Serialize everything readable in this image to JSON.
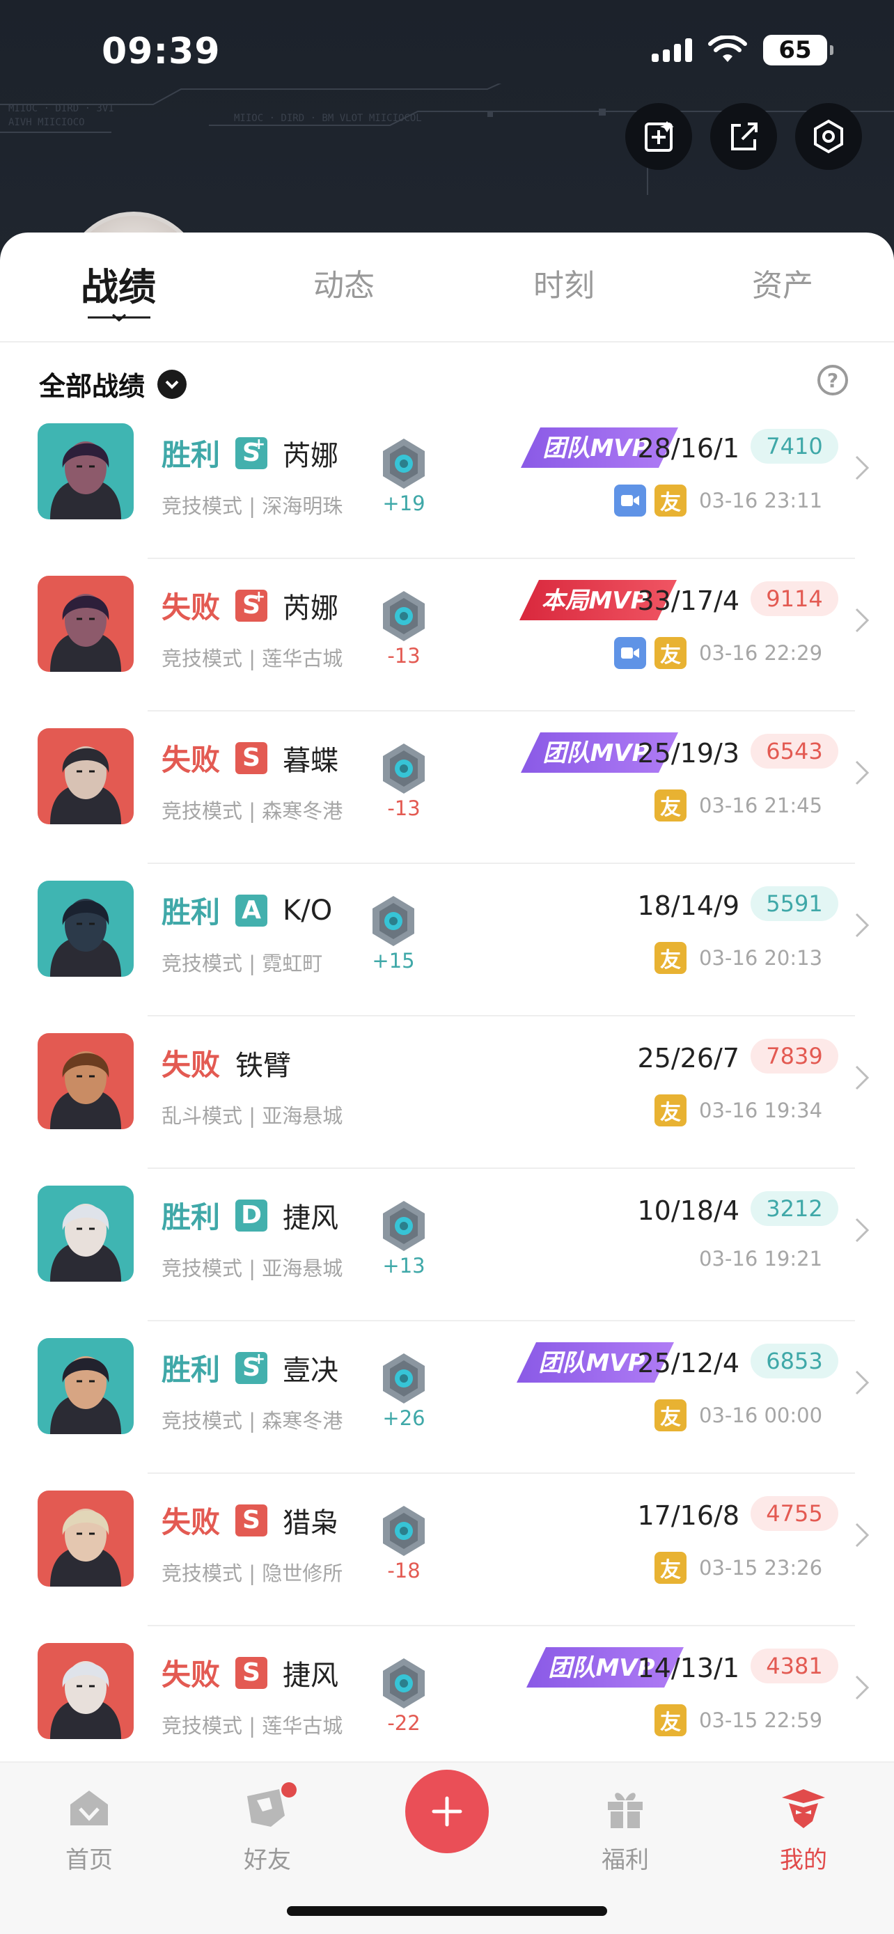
{
  "status_bar": {
    "time": "09:39",
    "battery": "65"
  },
  "tabs": [
    {
      "label": "战绩",
      "active": true
    },
    {
      "label": "动态"
    },
    {
      "label": "时刻"
    },
    {
      "label": "资产"
    }
  ],
  "filter": {
    "label": "全部战绩"
  },
  "matches": [
    {
      "result": "胜利",
      "outcome": "win",
      "grade": "S",
      "grade_plus": true,
      "hero": "芮娜",
      "mode_map": "竞技模式 | 深海明珠",
      "delta": "+19",
      "mvp": "团队MVP",
      "mvp_kind": "team",
      "kda": "28/16/1",
      "score": "7410",
      "video": true,
      "friend": true,
      "time": "03-16 23:11",
      "hero_color": "#3fb5b2"
    },
    {
      "result": "失败",
      "outcome": "loss",
      "grade": "S",
      "grade_plus": true,
      "hero": "芮娜",
      "mode_map": "竞技模式 | 莲华古城",
      "delta": "-13",
      "mvp": "本局MVP",
      "mvp_kind": "match",
      "kda": "33/17/4",
      "score": "9114",
      "video": true,
      "friend": true,
      "time": "03-16 22:29",
      "hero_color": "#e35a52"
    },
    {
      "result": "失败",
      "outcome": "loss",
      "grade": "S",
      "grade_plus": false,
      "hero": "暮蝶",
      "mode_map": "竞技模式 | 森寒冬港",
      "delta": "-13",
      "mvp": "团队MVP",
      "mvp_kind": "team",
      "kda": "25/19/3",
      "score": "6543",
      "video": false,
      "friend": true,
      "time": "03-16 21:45",
      "hero_color": "#e35a52"
    },
    {
      "result": "胜利",
      "outcome": "win",
      "grade": "A",
      "grade_plus": false,
      "hero": "K/O",
      "mode_map": "竞技模式 | 霓虹町",
      "delta": "+15",
      "mvp": "",
      "mvp_kind": "",
      "kda": "18/14/9",
      "score": "5591",
      "video": false,
      "friend": true,
      "time": "03-16 20:13",
      "hero_color": "#3fb5b2"
    },
    {
      "result": "失败",
      "outcome": "loss",
      "grade": "",
      "grade_plus": false,
      "hero": "铁臂",
      "mode_map": "乱斗模式 | 亚海悬城",
      "delta": "",
      "mvp": "",
      "mvp_kind": "",
      "kda": "25/26/7",
      "score": "7839",
      "video": false,
      "friend": true,
      "time": "03-16 19:34",
      "hero_color": "#e35a52"
    },
    {
      "result": "胜利",
      "outcome": "win",
      "grade": "D",
      "grade_plus": false,
      "hero": "捷风",
      "mode_map": "竞技模式 | 亚海悬城",
      "delta": "+13",
      "mvp": "",
      "mvp_kind": "",
      "kda": "10/18/4",
      "score": "3212",
      "video": false,
      "friend": false,
      "time": "03-16 19:21",
      "hero_color": "#3fb5b2"
    },
    {
      "result": "胜利",
      "outcome": "win",
      "grade": "S",
      "grade_plus": true,
      "hero": "壹决",
      "mode_map": "竞技模式 | 森寒冬港",
      "delta": "+26",
      "mvp": "团队MVP",
      "mvp_kind": "team",
      "kda": "25/12/4",
      "score": "6853",
      "video": false,
      "friend": true,
      "time": "03-16 00:00",
      "hero_color": "#3fb5b2"
    },
    {
      "result": "失败",
      "outcome": "loss",
      "grade": "S",
      "grade_plus": false,
      "hero": "猎枭",
      "mode_map": "竞技模式 | 隐世修所",
      "delta": "-18",
      "mvp": "",
      "mvp_kind": "",
      "kda": "17/16/8",
      "score": "4755",
      "video": false,
      "friend": true,
      "time": "03-15 23:26",
      "hero_color": "#e35a52"
    },
    {
      "result": "失败",
      "outcome": "loss",
      "grade": "S",
      "grade_plus": false,
      "hero": "捷风",
      "mode_map": "竞技模式 | 莲华古城",
      "delta": "-22",
      "mvp": "团队MVP",
      "mvp_kind": "team",
      "kda": "14/13/1",
      "score": "4381",
      "video": false,
      "friend": true,
      "time": "03-15 22:59",
      "hero_color": "#e35a52"
    }
  ],
  "tag_labels": {
    "friend": "友"
  },
  "bottom_nav": [
    {
      "label": "首页",
      "icon": "home-icon"
    },
    {
      "label": "好友",
      "icon": "friends-icon",
      "badge": true
    },
    {
      "label": "",
      "icon": "plus-icon"
    },
    {
      "label": "福利",
      "icon": "gift-icon"
    },
    {
      "label": "我的",
      "icon": "agent-icon",
      "active": true
    }
  ],
  "colors": {
    "win": "#3fa8a8",
    "loss": "#e35a52",
    "accent": "#ea4f57",
    "team_mvp": "#8a5ae6",
    "match_mvp": "#d9283d"
  }
}
